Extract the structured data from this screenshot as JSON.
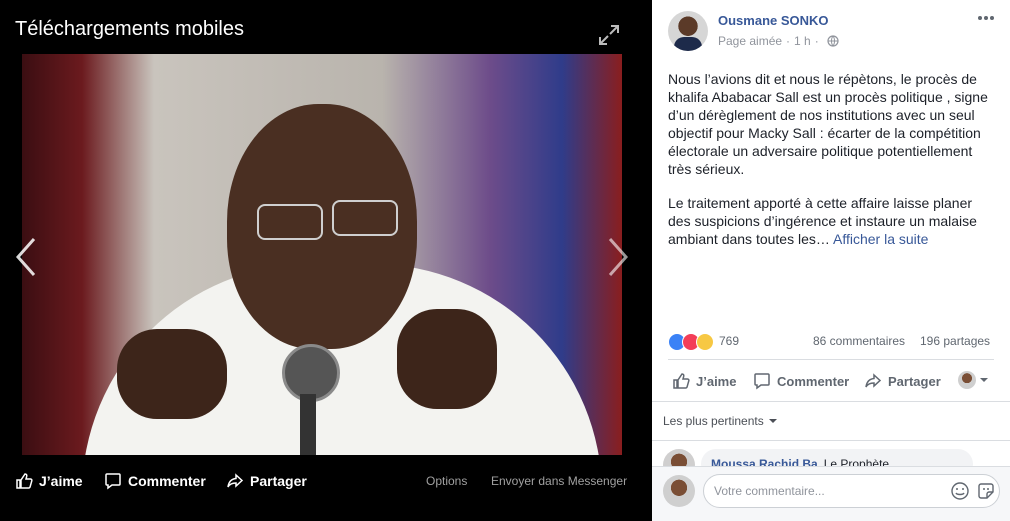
{
  "viewer": {
    "album_title": "Téléchargements mobiles",
    "bottom_bar": {
      "like": "J’aime",
      "comment": "Commenter",
      "share": "Partager",
      "options": "Options",
      "messenger": "Envoyer dans Messenger"
    }
  },
  "post": {
    "author": "Ousmane SONKO",
    "meta_liked": "Page aimée",
    "meta_sep": "·",
    "meta_time": "1 h",
    "meta_sep2": "·",
    "paragraph1": "Nous l’avions dit et nous le répètons, le procès de khalifa Ababacar Sall est un procès politique , signe d’un dérèglement de nos institutions avec un seul objectif pour Macky Sall : écarter de la compétition électorale un adversaire politique potentiellement très sérieux.",
    "paragraph2": "Le traitement apporté à cette affaire laisse planer des suspicions d’ingérence et instaure un malaise ambiant dans toutes les…",
    "see_more": "Afficher la suite",
    "reaction_count": "769",
    "comments_count": "86 commentaires",
    "shares_count": "196 partages",
    "actions": {
      "like": "J’aime",
      "comment": "Commenter",
      "share": "Partager"
    },
    "sort_label": "Les plus pertinents",
    "comment_preview": {
      "name": "Moussa Rachid Ba",
      "text": "Le Prophète"
    },
    "compose_placeholder": "Votre commentaire..."
  },
  "colors": {
    "link": "#385898",
    "viewer_bg": "#000000",
    "like_blue": "#3b82f6",
    "love_red": "#f33e58",
    "sad_yellow": "#f7c843"
  }
}
